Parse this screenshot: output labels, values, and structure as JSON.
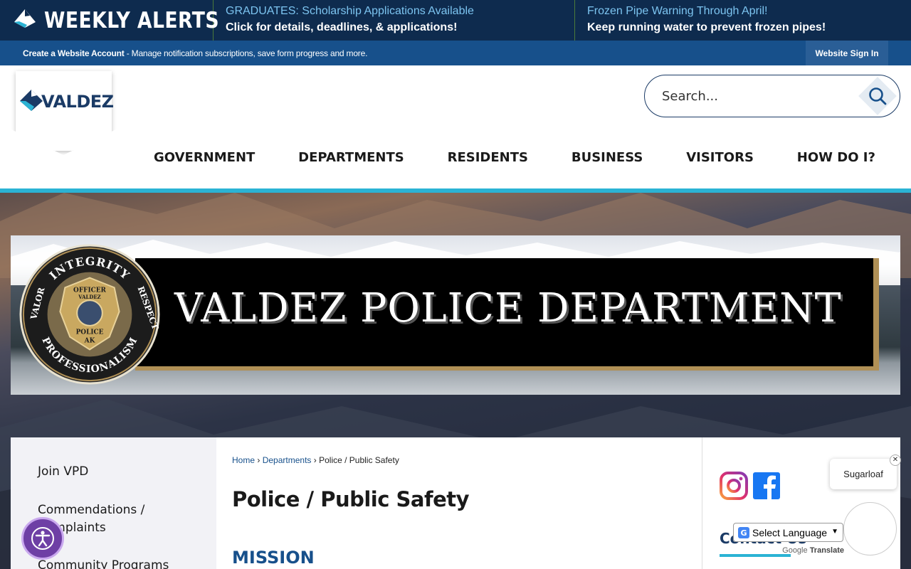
{
  "alerts": {
    "brand": "WEEKLY ALERTS",
    "items": [
      {
        "title": "GRADUATES: Scholarship Applications Available",
        "desc": "Click for details, deadlines, & applications!"
      },
      {
        "title": "Frozen Pipe Warning Through April!",
        "desc": "Keep running water to prevent frozen pipes!"
      }
    ]
  },
  "account": {
    "link": "Create a Website Account",
    "text": " - Manage notification subscriptions, save form progress and more.",
    "signin": "Website Sign In"
  },
  "header": {
    "logo_text": "VALDEZ",
    "search_placeholder": "Search..."
  },
  "nav": [
    "GOVERNMENT",
    "DEPARTMENTS",
    "RESIDENTS",
    "BUSINESS",
    "VISITORS",
    "HOW DO I?"
  ],
  "banner": {
    "title": "VALDEZ POLICE DEPARTMENT",
    "seal_words": [
      "INTEGRITY",
      "RESPECT",
      "PROFESSIONALISM",
      "VALOR"
    ],
    "badge_words": [
      "OFFICER",
      "VALDEZ",
      "POLICE",
      "AK"
    ]
  },
  "sidebar": {
    "items": [
      "Join VPD",
      "Commendations / Complaints",
      "Community Programs"
    ]
  },
  "main": {
    "breadcrumb": [
      "Home",
      "Departments",
      "Police / Public Safety"
    ],
    "title": "Police / Public Safety",
    "section": "MISSION"
  },
  "right": {
    "contact_heading": "Contact Us"
  },
  "popup": {
    "label": "Sugarloaf",
    "close": "✕"
  },
  "translate": {
    "select_label": "Select Language",
    "powered_prefix": "Google",
    "powered_suffix": "Translate"
  },
  "colors": {
    "navy": "#0e2b4e",
    "account_blue": "#17508b",
    "teal": "#2bb3d4",
    "gold": "#b09056",
    "accessibility_purple": "#6e3fa5"
  }
}
